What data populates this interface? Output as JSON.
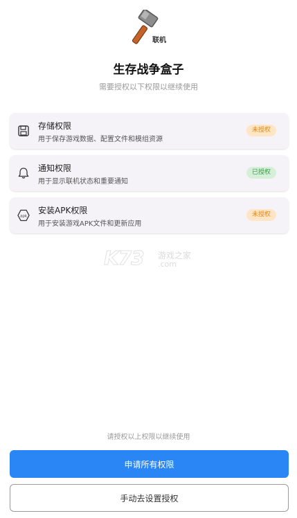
{
  "app": {
    "logo_text": "联机",
    "title": "生存战争盒子",
    "subtitle": "需要授权以下权限以继续使用"
  },
  "permissions": [
    {
      "icon": "floppy-disk-icon",
      "title": "存储权限",
      "desc": "用于保存游戏数据、配置文件和模组资源",
      "status": "未授权",
      "status_color": "#e08a1e"
    },
    {
      "icon": "bell-icon",
      "title": "通知权限",
      "desc": "用于显示联机状态和重要通知",
      "status": "已授权",
      "status_color": "#3c9a4a"
    },
    {
      "icon": "apk-icon",
      "title": "安装APK权限",
      "desc": "用于安装游戏APK文件和更新应用",
      "status": "未授权",
      "status_color": "#e08a1e"
    }
  ],
  "watermark": {
    "main": "K73",
    "cn": "游戏之家",
    "com": ".com"
  },
  "footer": {
    "hint": "请授权以上权限以继续使用",
    "primary_button": "申请所有权限",
    "secondary_button": "手动去设置授权"
  },
  "colors": {
    "accent": "#2a86f4",
    "pending": "#e08a1e",
    "granted": "#3c9a4a"
  }
}
